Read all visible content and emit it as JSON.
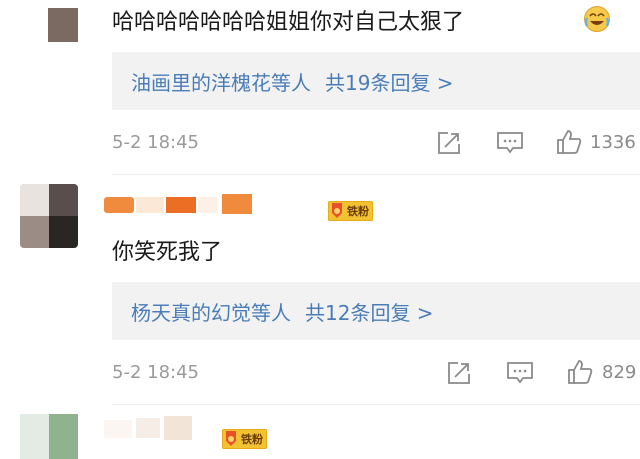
{
  "comments": [
    {
      "text": "哈哈哈哈哈哈哈姐姐你对自己太狠了",
      "emoji": "laughing-crying-emoji",
      "replies": {
        "names": "油画里的洋槐花",
        "suffix": "等人",
        "count_text": "共19条回复 >"
      },
      "time": "5-2 18:45",
      "likes": "1336"
    },
    {
      "badge": "铁粉",
      "text": "你笑死我了",
      "replies": {
        "names": "杨天真的幻觉",
        "suffix": "等人",
        "count_text": "共12条回复 >"
      },
      "time": "5-2 18:45",
      "likes": "829"
    },
    {
      "badge": "铁粉"
    }
  ],
  "icons": [
    "share-icon",
    "comment-icon",
    "thumbs-up-icon"
  ],
  "colors": {
    "link": "#4a7db8",
    "meta": "#9a9a9a",
    "reply_bg": "#f2f2f2",
    "badge": "#f3c232"
  }
}
